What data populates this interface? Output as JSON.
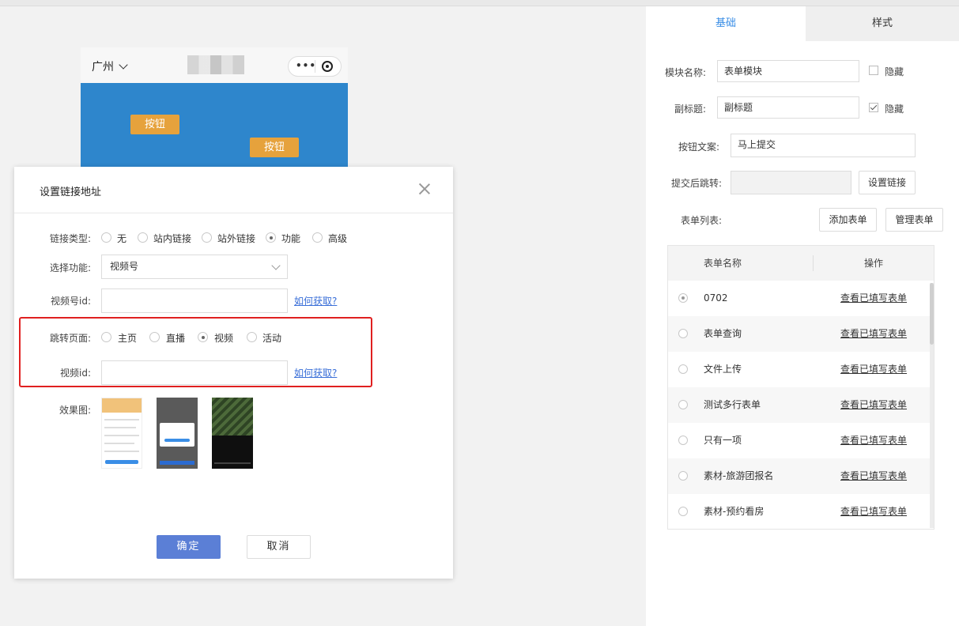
{
  "phone": {
    "city": "广州",
    "buttons": [
      "按钮",
      "按钮"
    ]
  },
  "panel": {
    "tabs": [
      {
        "label": "基础",
        "active": true
      },
      {
        "label": "样式",
        "active": false
      }
    ],
    "module_name_label": "模块名称:",
    "module_name_value": "表单模块",
    "hide_label": "隐藏",
    "subtitle_label": "副标题:",
    "subtitle_value": "副标题",
    "button_text_label": "按钮文案:",
    "button_text_value": "马上提交",
    "redirect_label": "提交后跳转:",
    "set_link_button": "设置链接",
    "form_list_label": "表单列表:",
    "add_form_button": "添加表单",
    "manage_form_button": "管理表单",
    "table": {
      "headers": [
        "表单名称",
        "操作"
      ],
      "rows": [
        {
          "name": "0702",
          "action": "查看已填写表单",
          "selected": true
        },
        {
          "name": "表单查询",
          "action": "查看已填写表单",
          "selected": false
        },
        {
          "name": "文件上传",
          "action": "查看已填写表单",
          "selected": false
        },
        {
          "name": "测试多行表单",
          "action": "查看已填写表单",
          "selected": false
        },
        {
          "name": "只有一项",
          "action": "查看已填写表单",
          "selected": false
        },
        {
          "name": "素材-旅游团报名",
          "action": "查看已填写表单",
          "selected": false
        },
        {
          "name": "素材-预约看房",
          "action": "查看已填写表单",
          "selected": false
        }
      ]
    }
  },
  "modal": {
    "title": "设置链接地址",
    "link_type_label": "链接类型:",
    "link_types": [
      {
        "label": "无",
        "selected": false
      },
      {
        "label": "站内链接",
        "selected": false
      },
      {
        "label": "站外链接",
        "selected": false
      },
      {
        "label": "功能",
        "selected": true
      },
      {
        "label": "高级",
        "selected": false
      }
    ],
    "function_label": "选择功能:",
    "function_value": "视频号",
    "channel_id_label": "视频号id:",
    "how_to_get": "如何获取?",
    "jump_page_label": "跳转页面:",
    "jump_pages": [
      {
        "label": "主页",
        "selected": false
      },
      {
        "label": "直播",
        "selected": false
      },
      {
        "label": "视频",
        "selected": true
      },
      {
        "label": "活动",
        "selected": false
      }
    ],
    "video_id_label": "视频id:",
    "preview_label": "效果图:",
    "confirm": "确定",
    "cancel": "取消"
  }
}
